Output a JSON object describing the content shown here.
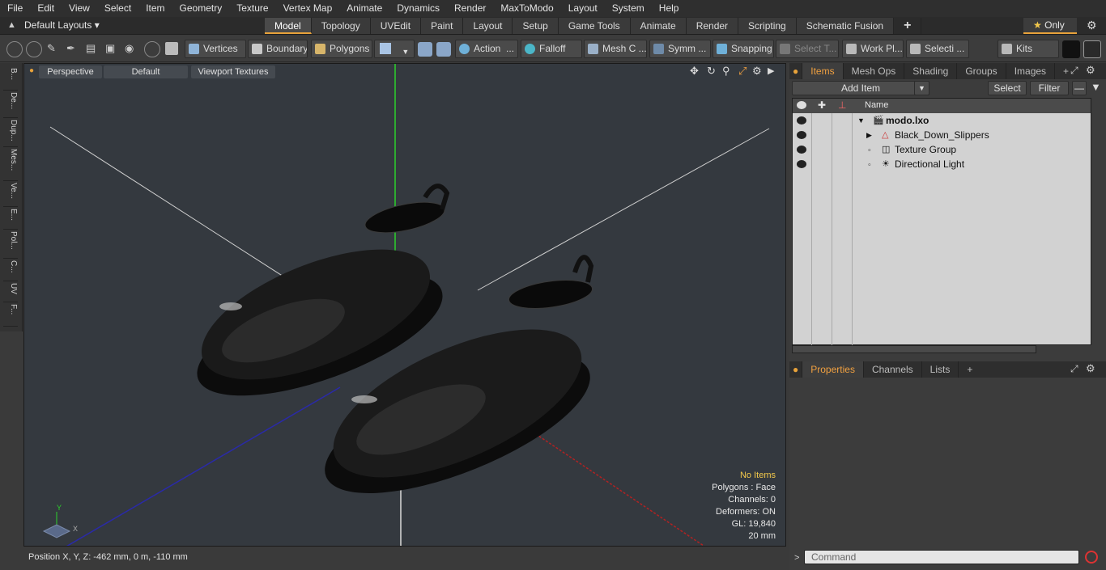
{
  "menu": [
    "File",
    "Edit",
    "View",
    "Select",
    "Item",
    "Geometry",
    "Texture",
    "Vertex Map",
    "Animate",
    "Dynamics",
    "Render",
    "MaxToModo",
    "Layout",
    "System",
    "Help"
  ],
  "layout": {
    "label": "Default Layouts ▾"
  },
  "tabs": [
    "Model",
    "Topology",
    "UVEdit",
    "Paint",
    "Layout",
    "Setup",
    "Game Tools",
    "Animate",
    "Render",
    "Scripting",
    "Schematic Fusion"
  ],
  "only_label": "Only",
  "toolbar": {
    "vertices": "Vertices",
    "boundary": "Boundary",
    "polygons": "Polygons",
    "action": "Action",
    "falloff": "Falloff",
    "mesh": "Mesh C ...",
    "symm": "Symm ...",
    "snapping": "Snapping",
    "select_t": "Select T...",
    "workpl": "Work Pl...",
    "selecti": "Selecti ...",
    "kits": "Kits"
  },
  "left_tabs": [
    "B...",
    "De...",
    "Dup...",
    "Mes...",
    "Ve...",
    "E...",
    "Pol...",
    "C...",
    "UV",
    "F..."
  ],
  "viewport": {
    "perspective": "Perspective",
    "default": "Default",
    "textures": "Viewport Textures",
    "hud": {
      "no_items": "No Items",
      "polygons": "Polygons : Face",
      "channels": "Channels: 0",
      "deformers": "Deformers: ON",
      "gl": "GL: 19,840",
      "scale": "20 mm"
    }
  },
  "status": {
    "position": "Position X, Y, Z:   -462 mm, 0 m, -110 mm"
  },
  "items_panel": {
    "tabs": [
      "Items",
      "Mesh Ops",
      "Shading",
      "Groups",
      "Images"
    ],
    "add_item": "Add Item",
    "select": "Select",
    "filter": "Filter",
    "name_header": "Name",
    "rows": [
      "modo.lxo",
      "Black_Down_Slippers",
      "Texture Group",
      "Directional Light"
    ]
  },
  "props_panel": {
    "tabs": [
      "Properties",
      "Channels",
      "Lists"
    ]
  },
  "command": {
    "placeholder": "Command"
  }
}
